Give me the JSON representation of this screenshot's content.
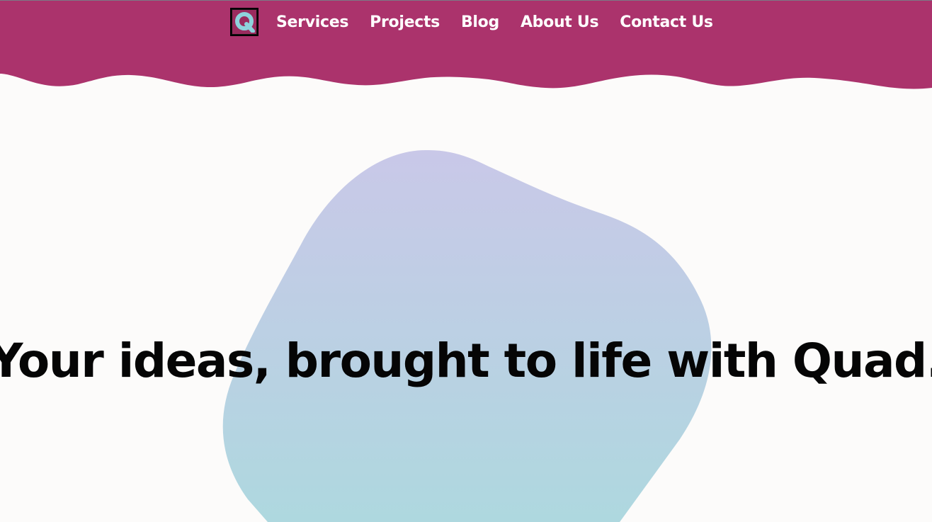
{
  "colors": {
    "header_bg": "#ab336c",
    "page_bg": "#fcfbfa",
    "nav_text": "#ffffff",
    "logo_accent": "#8ed3dc",
    "blob_top": "#c9c8e8",
    "blob_bottom": "#aed8df",
    "heading_text": "#050505"
  },
  "header": {
    "logo": {
      "icon": "quad-logo-icon",
      "letter": "Q"
    },
    "nav": [
      {
        "label": "Services"
      },
      {
        "label": "Projects"
      },
      {
        "label": "Blog"
      },
      {
        "label": "About Us"
      },
      {
        "label": "Contact Us"
      }
    ]
  },
  "hero": {
    "title": "Your ideas, brought to life with Quad."
  }
}
